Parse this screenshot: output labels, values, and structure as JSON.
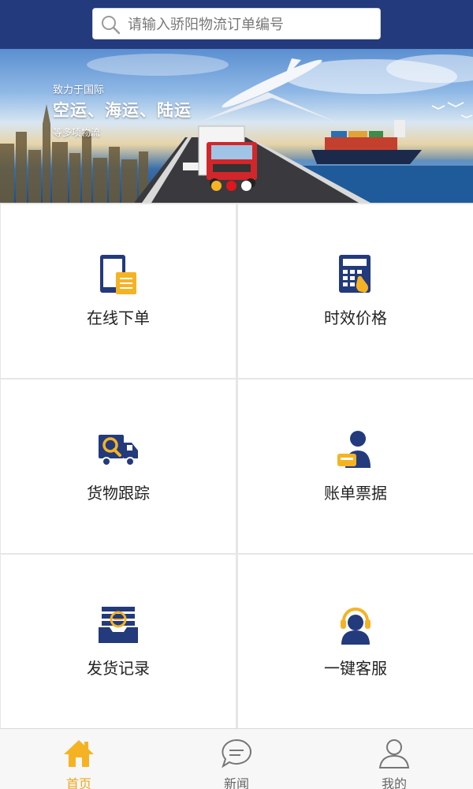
{
  "search": {
    "placeholder": "请输入骄阳物流订单编号"
  },
  "banner": {
    "line1": "致力于国际",
    "line2": "空运、海运、陆运",
    "line3": "等多项物流",
    "slides": 3,
    "active_slide": 1
  },
  "tiles": [
    {
      "label": "在线下单",
      "icon": "tablet-order-icon"
    },
    {
      "label": "时效价格",
      "icon": "calculator-icon"
    },
    {
      "label": "货物跟踪",
      "icon": "truck-search-icon"
    },
    {
      "label": "账单票据",
      "icon": "person-bill-icon"
    },
    {
      "label": "发货记录",
      "icon": "record-tray-icon"
    },
    {
      "label": "一键客服",
      "icon": "headset-agent-icon"
    }
  ],
  "tabbar": {
    "items": [
      {
        "label": "首页",
        "icon": "home-icon",
        "active": true
      },
      {
        "label": "新闻",
        "icon": "chat-bubble-icon",
        "active": false
      },
      {
        "label": "我的",
        "icon": "user-icon",
        "active": false
      }
    ]
  },
  "colors": {
    "header": "#233a7c",
    "accent": "#f0a81c",
    "icon_blue": "#233a7c",
    "icon_yellow": "#f5b324",
    "dot_active": "#e0161a"
  }
}
